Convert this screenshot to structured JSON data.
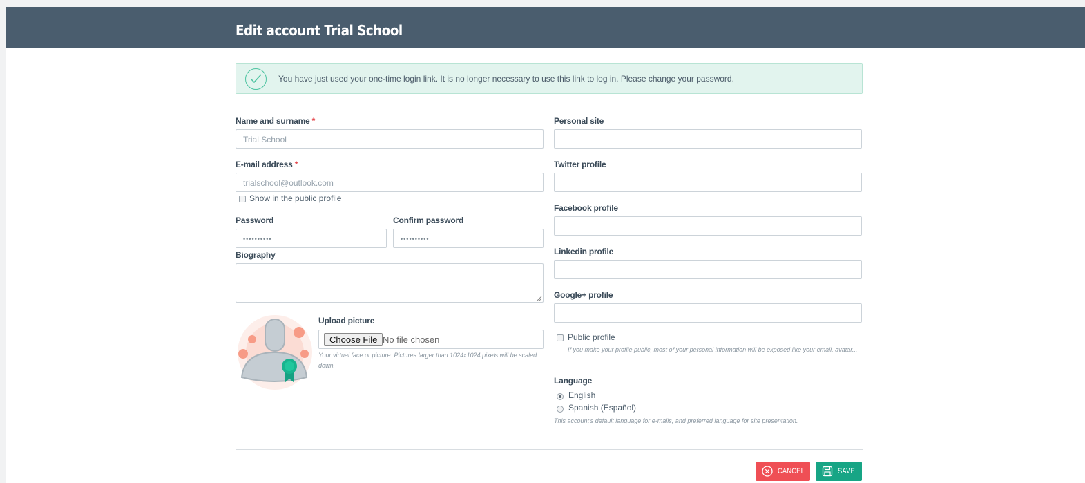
{
  "header": {
    "title": "Edit account Trial School"
  },
  "alert": {
    "icon": "check-circle-icon",
    "message": "You have just used your one-time login link. It is no longer necessary to use this link to log in. Please change your password."
  },
  "form": {
    "name": {
      "label": "Name and surname",
      "required": "*",
      "value": "Trial School"
    },
    "email": {
      "label": "E-mail address",
      "required": "*",
      "value": "trialschool@outlook.com"
    },
    "show_public": {
      "label": "Show in the public profile",
      "checked": false
    },
    "password": {
      "label": "Password",
      "value": "••••••••••"
    },
    "confirm_password": {
      "label": "Confirm password",
      "value": "••••••••••"
    },
    "biography": {
      "label": "Biography",
      "value": ""
    },
    "upload": {
      "label": "Upload picture",
      "button": "Choose File",
      "status": "No file chosen",
      "help": "Your virtual face or picture. Pictures larger than 1024x1024 pixels will be scaled down."
    },
    "personal_site": {
      "label": "Personal site",
      "value": ""
    },
    "twitter": {
      "label": "Twitter profile",
      "value": ""
    },
    "facebook": {
      "label": "Facebook profile",
      "value": ""
    },
    "linkedin": {
      "label": "Linkedin profile",
      "value": ""
    },
    "googleplus": {
      "label": "Google+ profile",
      "value": ""
    },
    "public_profile": {
      "label": "Public profile",
      "checked": false,
      "help": "If you make your profile public, most of your personal information will be exposed like your email, avatar..."
    },
    "language": {
      "label": "Language",
      "options": [
        "English",
        "Spanish (Español)"
      ],
      "selected": "English",
      "help": "This account's default language for e-mails, and preferred language for site presentation."
    }
  },
  "actions": {
    "cancel": "CANCEL",
    "save": "SAVE"
  },
  "colors": {
    "header": "#4a5d6e",
    "cancel": "#ef4f55",
    "save": "#17a585",
    "alert_bg": "#e2f4ee"
  }
}
